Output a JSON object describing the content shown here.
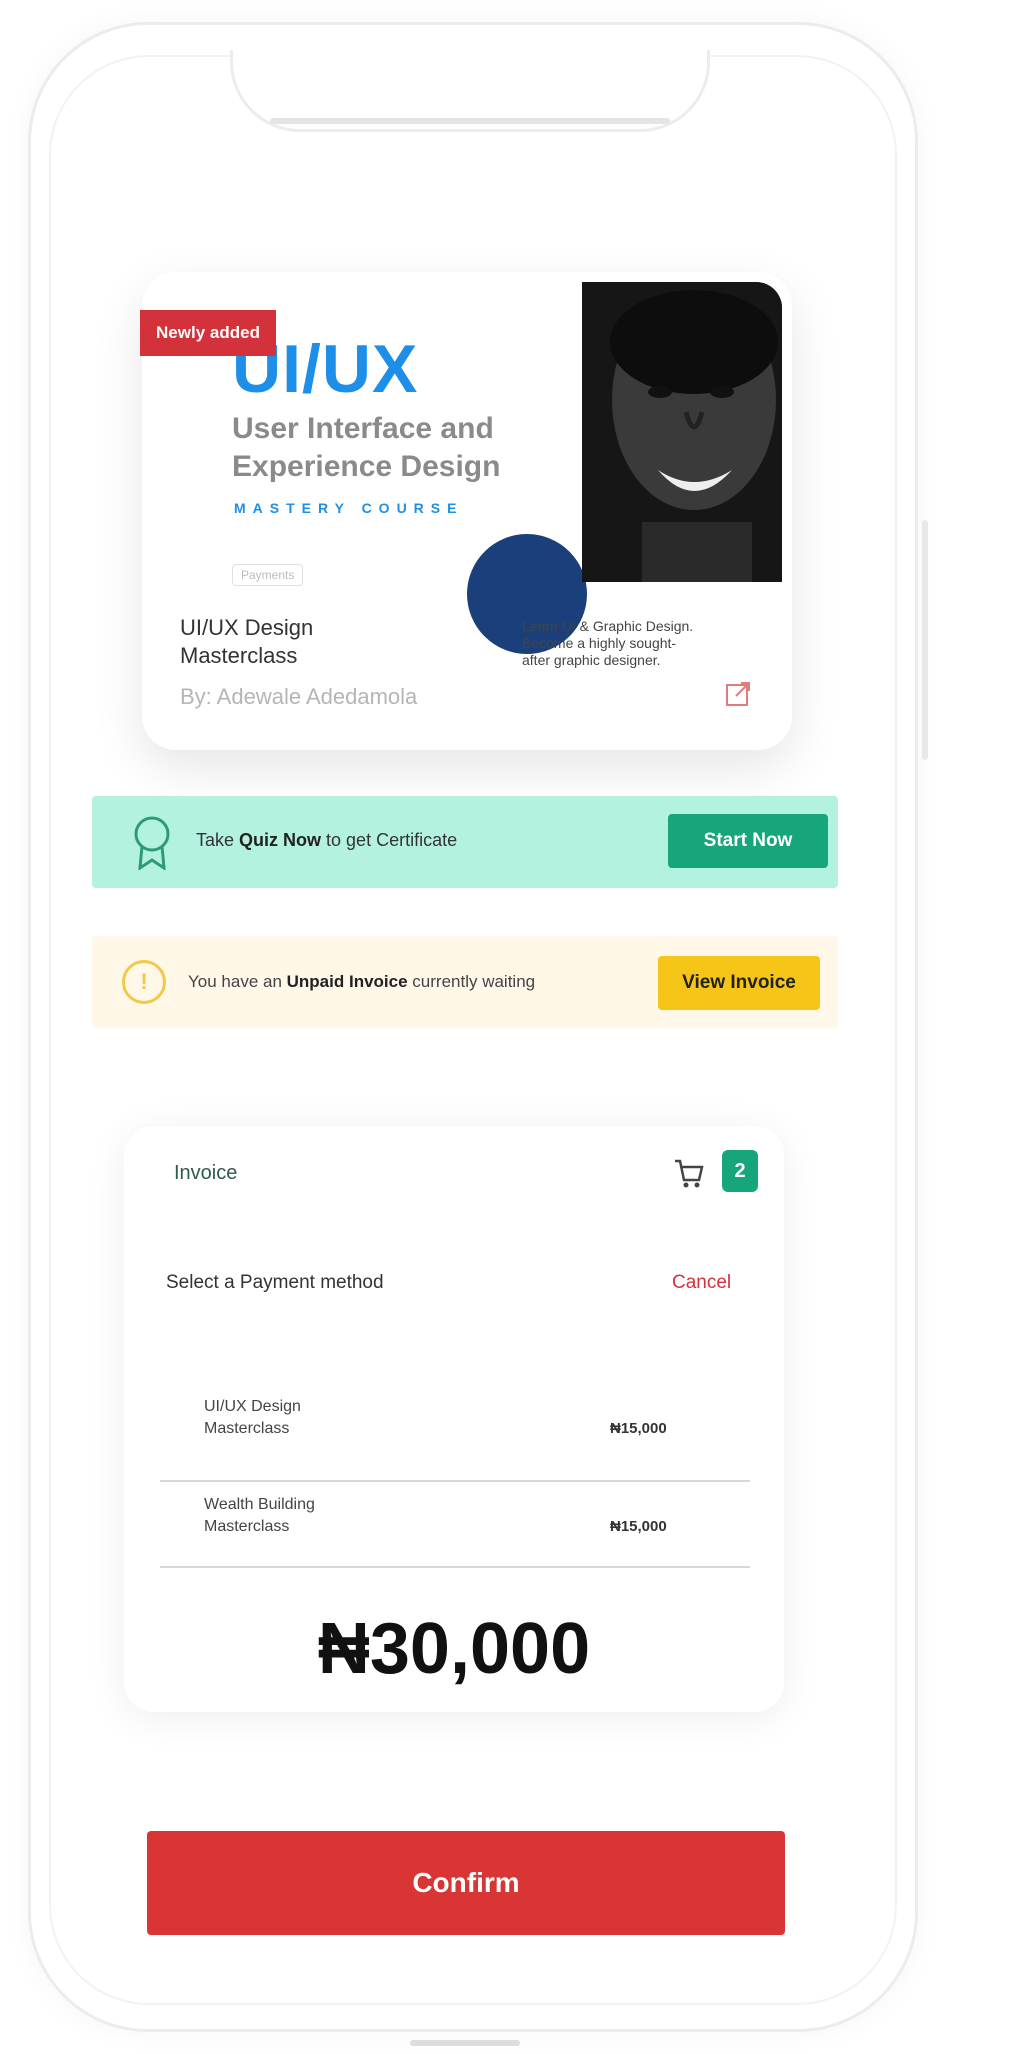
{
  "course": {
    "badge": "Newly added",
    "banner_title": "UI/UX",
    "banner_subtitle": "User Interface and Experience Design",
    "banner_mastery": "MASTERY COURSE",
    "banner_tag": "Payments",
    "name": "UI/UX Design Masterclass",
    "author": "By: Adewale Adedamola",
    "description": "Learn UI & Graphic Design. Become a highly sought-after graphic designer."
  },
  "quiz_banner": {
    "text_pre": "Take ",
    "text_bold": "Quiz Now",
    "text_post": " to get Certificate",
    "button_label": "Start Now"
  },
  "invoice_banner": {
    "text_pre": "You have an ",
    "text_bold": "Unpaid Invoice",
    "text_post": " currently waiting",
    "button_label": "View Invoice"
  },
  "invoice": {
    "label": "Invoice",
    "cart_count": "2",
    "payment_method_label": "Select a Payment method",
    "cancel_label": "Cancel",
    "items": [
      {
        "name": "UI/UX Design Masterclass",
        "price": "₦15,000"
      },
      {
        "name": "Wealth Building Masterclass",
        "price": "₦15,000"
      }
    ],
    "total": "₦30,000"
  },
  "confirm_label": "Confirm",
  "colors": {
    "accent_red": "#d93535",
    "accent_green": "#17a67b",
    "accent_yellow": "#f5c518",
    "brand_blue": "#1e8fe8"
  }
}
